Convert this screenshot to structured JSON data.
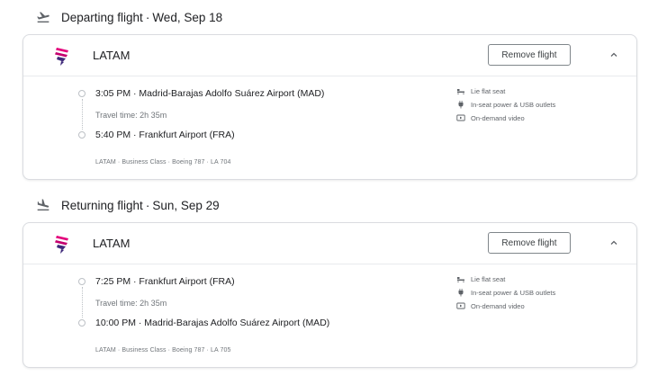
{
  "departing": {
    "label": "Departing flight",
    "separator": "·",
    "date": "Wed, Sep 18",
    "airline": "LATAM",
    "remove_label": "Remove flight",
    "departure": "3:05 PM · Madrid-Barajas Adolfo Suárez Airport (MAD)",
    "travel_time": "Travel time: 2h 35m",
    "arrival": "5:40 PM · Frankfurt Airport (FRA)",
    "details": "LATAM · Business Class · Boeing 787 · LA 704",
    "amenities": [
      {
        "icon": "lie-flat-seat-icon",
        "label": "Lie flat seat"
      },
      {
        "icon": "power-outlet-icon",
        "label": "In-seat power & USB outlets"
      },
      {
        "icon": "video-icon",
        "label": "On-demand video"
      }
    ]
  },
  "returning": {
    "label": "Returning flight",
    "separator": "·",
    "date": "Sun, Sep 29",
    "airline": "LATAM",
    "remove_label": "Remove flight",
    "departure": "7:25 PM · Frankfurt Airport (FRA)",
    "travel_time": "Travel time: 2h 35m",
    "arrival": "10:00 PM · Madrid-Barajas Adolfo Suárez Airport (MAD)",
    "details": "LATAM · Business Class · Boeing 787 · LA 705",
    "amenities": [
      {
        "icon": "lie-flat-seat-icon",
        "label": "Lie flat seat"
      },
      {
        "icon": "power-outlet-icon",
        "label": "In-seat power & USB outlets"
      },
      {
        "icon": "video-icon",
        "label": "On-demand video"
      }
    ]
  },
  "colors": {
    "logo_magenta": "#e3007b",
    "logo_purple": "#3f2a7a",
    "border": "#dadce0",
    "muted_text": "#70757a"
  }
}
